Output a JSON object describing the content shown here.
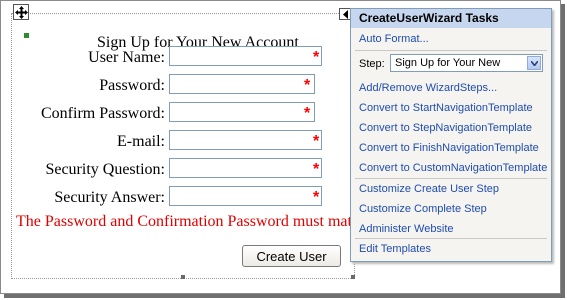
{
  "form": {
    "title": "Sign Up for Your New Account",
    "fields": [
      {
        "label": "User Name:",
        "required_mark": "*"
      },
      {
        "label": "Password:",
        "required_mark": "*"
      },
      {
        "label": "Confirm Password:",
        "required_mark": "*"
      },
      {
        "label": "E-mail:",
        "required_mark": "*"
      },
      {
        "label": "Security Question:",
        "required_mark": "*"
      },
      {
        "label": "Security Answer:",
        "required_mark": "*"
      }
    ],
    "error_message": "The Password and Confirmation Password must match.",
    "submit_label": "Create User"
  },
  "tasks_panel": {
    "title": "CreateUserWizard Tasks",
    "auto_format": "Auto Format...",
    "step_label": "Step:",
    "step_value": "Sign Up for Your New",
    "links": [
      "Add/Remove WizardSteps...",
      "Convert to StartNavigationTemplate",
      "Convert to StepNavigationTemplate",
      "Convert to FinishNavigationTemplate",
      "Convert to CustomNavigationTemplate",
      "Customize Create User Step",
      "Customize Complete Step",
      "Administer Website",
      "Edit Templates"
    ]
  },
  "colors": {
    "error": "#e00000",
    "required": "#ff0000",
    "link": "#1f4cae",
    "panel_header": "#c5d6ee"
  },
  "icons": [
    "move-handle-icon",
    "smart-tag-arrow-icon",
    "dropdown-arrow-icon"
  ]
}
